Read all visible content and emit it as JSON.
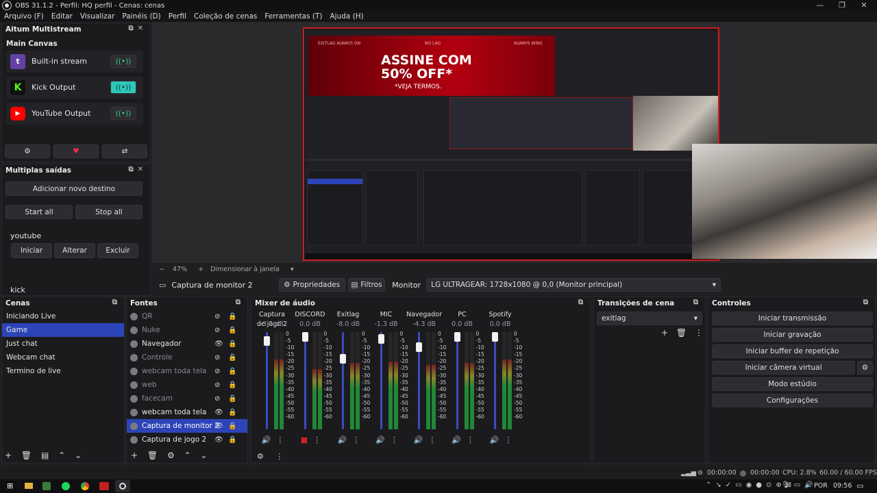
{
  "window": {
    "title": "OBS 31.1.2 - Perfil: HQ perfil - Cenas: cenas",
    "minimize": "—",
    "maximize": "❐",
    "close": "✕"
  },
  "menu": [
    "Arquivo (F)",
    "Editar",
    "Visualizar",
    "Painéis (D)",
    "Perfil",
    "Coleção de cenas",
    "Ferramentas (T)",
    "Ajuda (H)"
  ],
  "multistream": {
    "title": "Aitum Multistream",
    "section": "Main Canvas",
    "outputs": [
      {
        "label": "Built-in stream",
        "color": "#6441a5",
        "glyph": "t"
      },
      {
        "label": "Kick Output",
        "color": "#53fc18",
        "glyph": "K"
      },
      {
        "label": "YouTube Output",
        "color": "#ff0000",
        "glyph": "▶"
      }
    ],
    "stream_icon": "((•))",
    "gear": "⚙",
    "heart": "♥",
    "share": "⇄"
  },
  "multiple_outputs": {
    "title": "Multiplas saídas",
    "add_button": "Adicionar novo destino",
    "start_all": "Start all",
    "stop_all": "Stop all",
    "destination": "youtube",
    "start": "Iniciar",
    "edit": "Alterar",
    "delete": "Excluir",
    "next_destination": "kick"
  },
  "preview": {
    "zoom_minus": "−",
    "zoom": "47%",
    "zoom_plus": "+",
    "resize_mode": "Dimensionar à janela",
    "ad_top_left": "EXITLAG ALWAYS ON",
    "ad_top_mid": "NO LAG",
    "ad_top_right": "ALWAYS WINS",
    "ad_line1": "ASSINE COM",
    "ad_line2": "50% OFF*",
    "ad_line3": "*VEJA TERMOS."
  },
  "source_toolbar": {
    "source_name": "Captura de monitor 2",
    "properties": "Propriedades",
    "filters": "Filtros",
    "monitor_label": "Monitor",
    "monitor_value": "LG ULTRAGEAR: 1728x1080 @ 0,0 (Monitor principal)"
  },
  "scenes": {
    "title": "Cenas",
    "items": [
      "Iniciando Live",
      "Game",
      "Just chat",
      "Webcam chat",
      "Termino de live"
    ],
    "selected": 1
  },
  "sources": {
    "title": "Fontes",
    "items": [
      {
        "name": "QR",
        "visible": false
      },
      {
        "name": "Nuke",
        "visible": false
      },
      {
        "name": "Navegador",
        "visible": true
      },
      {
        "name": "Controle",
        "visible": false
      },
      {
        "name": "webcam toda tela",
        "visible": false
      },
      {
        "name": "web",
        "visible": false
      },
      {
        "name": "facecam",
        "visible": false
      },
      {
        "name": "webcam toda tela",
        "visible": true
      },
      {
        "name": "Captura de monitor 2",
        "visible": true
      },
      {
        "name": "Captura de jogo 2",
        "visible": true
      }
    ],
    "selected": 8
  },
  "mixer": {
    "title": "Mixer de áudio",
    "channels": [
      {
        "name": "Captura de jogo 2",
        "db": "-3.2 dB",
        "level": 0.95,
        "meter": 0.72
      },
      {
        "name": "DISCORD",
        "db": "0.0 dB",
        "level": 1.0,
        "meter": 0.62
      },
      {
        "name": "Exitlag",
        "db": "-8.0 dB",
        "level": 0.75,
        "meter": 0.68
      },
      {
        "name": "MIC",
        "db": "-1.3 dB",
        "level": 0.98,
        "meter": 0.7
      },
      {
        "name": "Navegador",
        "db": "-4.3 dB",
        "level": 0.88,
        "meter": 0.66
      },
      {
        "name": "PC",
        "db": "0.0 dB",
        "level": 1.0,
        "meter": 0.68
      },
      {
        "name": "Spotify",
        "db": "0.0 dB",
        "level": 1.0,
        "meter": 0.72
      }
    ],
    "scale": [
      "0",
      "-5",
      "-10",
      "-15",
      "-20",
      "-25",
      "-30",
      "-35",
      "-40",
      "-45",
      "-50",
      "-55",
      "-60"
    ]
  },
  "transitions": {
    "title": "Transições de cena",
    "selected": "exitlag"
  },
  "controls": {
    "title": "Controles",
    "buttons": [
      "Iniciar transmissão",
      "Iniciar gravação",
      "Iniciar buffer de repetição",
      "Iniciar câmera virtual",
      "Modo estúdio",
      "Configurações"
    ]
  },
  "status": {
    "stream_time": "00:00:00",
    "rec_time": "00:00:00",
    "cpu": "CPU: 2.8%",
    "fps": "60.00 / 60.00 FPS"
  },
  "taskbar": {
    "lang": "POR",
    "time": "09:56"
  }
}
